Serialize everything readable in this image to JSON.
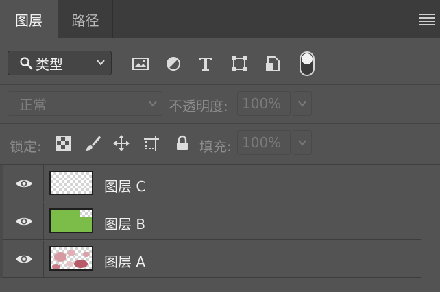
{
  "tabs": [
    {
      "label": "图层",
      "active": true
    },
    {
      "label": "路径",
      "active": false
    }
  ],
  "filter": {
    "kind_label": "类型",
    "icons": [
      "image-filter-icon",
      "adjustment-filter-icon",
      "type-filter-icon",
      "shape-filter-icon",
      "smart-object-filter-icon",
      "filter-toggle"
    ]
  },
  "blend": {
    "mode": "正常",
    "opacity_label": "不透明度:",
    "opacity_value": "100%"
  },
  "lock": {
    "label": "锁定:",
    "fill_label": "填充:",
    "fill_value": "100%"
  },
  "layers": [
    {
      "name": "图层 C",
      "visible": true,
      "thumbnail": "transparent"
    },
    {
      "name": "图层 B",
      "visible": true,
      "thumbnail": "green",
      "fill_color": "#7bbd48"
    },
    {
      "name": "图层 A",
      "visible": true,
      "thumbnail": "pink-pattern",
      "fill_color": "#c98c94"
    }
  ],
  "colors": {
    "panel_bg": "#535353",
    "tabbar_bg": "#3c3c3c",
    "green_fill": "#7bbd48"
  }
}
